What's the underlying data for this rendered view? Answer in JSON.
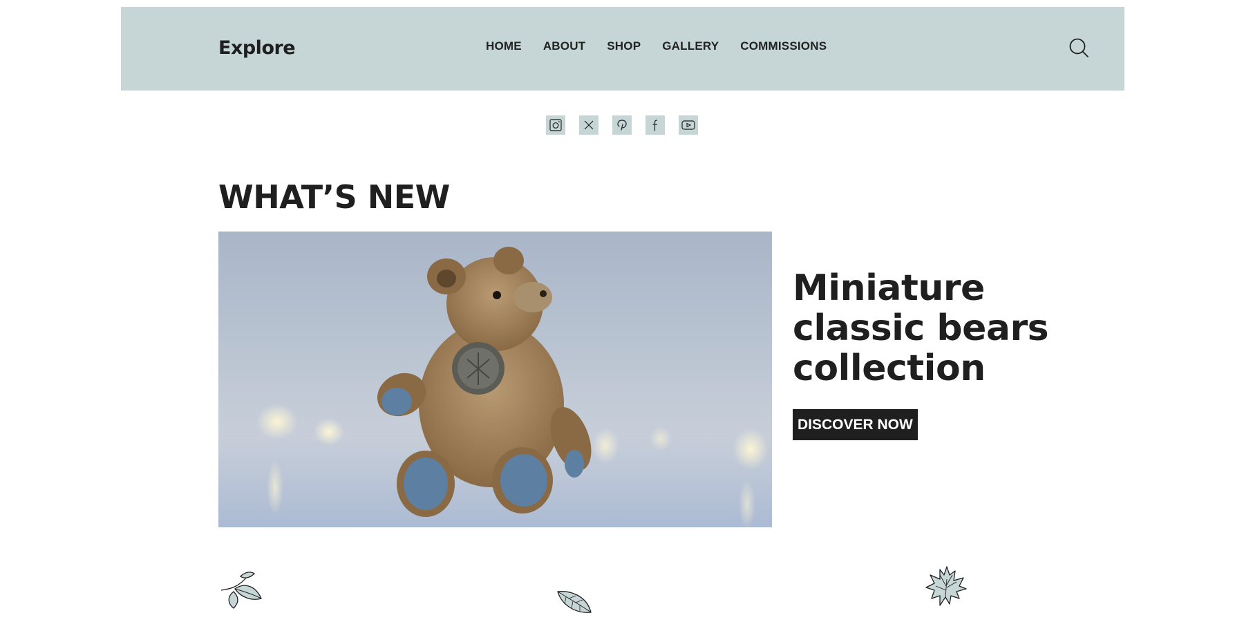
{
  "header": {
    "logo": "Explore",
    "nav": [
      "HOME",
      "ABOUT",
      "SHOP",
      "GALLERY",
      "COMMISSIONS"
    ],
    "search_icon": "search-icon"
  },
  "social": {
    "icons": [
      "instagram-icon",
      "x-icon",
      "pinterest-icon",
      "facebook-icon",
      "youtube-icon"
    ]
  },
  "main": {
    "section_title": "WHAT’S NEW",
    "featured": {
      "heading": "Miniature classic bears collection",
      "cta_label": "DISCOVER NOW",
      "image": "teddy-bear-photo"
    }
  },
  "decorations": [
    "leaf-sprig-icon",
    "leaf-icon",
    "maple-leaf-icon"
  ],
  "colors": {
    "header_bg": "#c6d6d6",
    "text": "#1f1f1f",
    "button_bg": "#1f1f1f",
    "button_text": "#ffffff"
  }
}
